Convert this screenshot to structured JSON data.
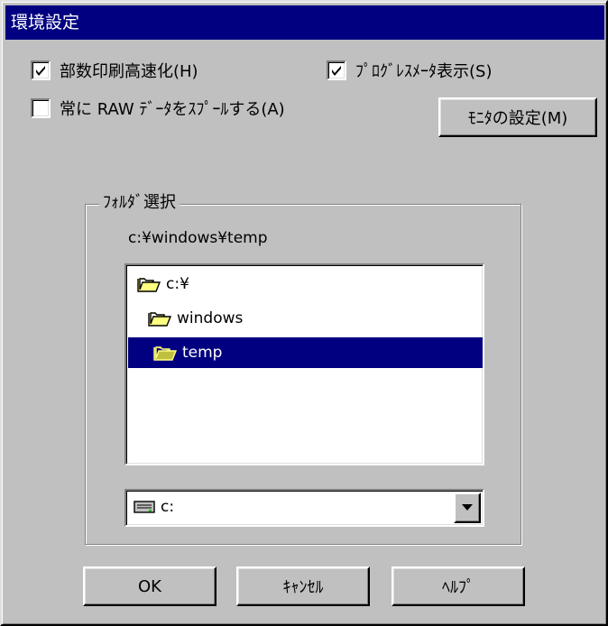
{
  "window": {
    "title": "環境設定"
  },
  "options": {
    "high_speed_print": {
      "label": "部数印刷高速化(H)",
      "checked": true
    },
    "progress_meter": {
      "label": "ﾌﾟﾛｸﾞﾚｽﾒｰﾀ表示(S)",
      "checked": true
    },
    "always_raw_spool": {
      "label": "常に RAW ﾃﾞｰﾀをｽﾌﾟｰﾙする(A)",
      "checked": false
    }
  },
  "buttons": {
    "monitor_settings": "ﾓﾆﾀの設定(M)",
    "ok": "OK",
    "cancel": "ｷｬﾝｾﾙ",
    "help": "ﾍﾙﾌﾟ"
  },
  "folder_select": {
    "group_title": "ﾌｫﾙﾀﾞ選択",
    "current_path": "c:¥windows¥temp",
    "folders": [
      {
        "name": "c:¥",
        "icon": "open-folder-icon",
        "selected": false
      },
      {
        "name": "windows",
        "icon": "open-folder-icon",
        "selected": false
      },
      {
        "name": "temp",
        "icon": "open-folder-icon",
        "selected": true
      }
    ],
    "drive": {
      "value": "c:",
      "icon": "drive-icon"
    }
  },
  "colors": {
    "title_bar": "#000080",
    "dialog_face": "#c0c0c0",
    "selection": "#000080"
  }
}
